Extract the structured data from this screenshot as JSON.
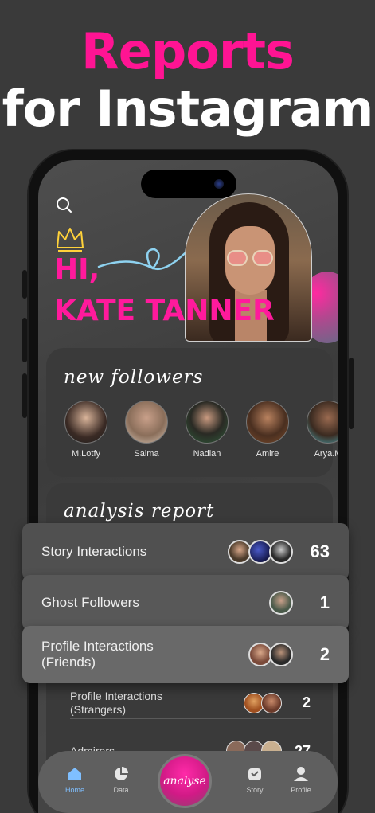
{
  "headline": {
    "line1": "Reports",
    "line2": "for Instagram"
  },
  "colors": {
    "accent": "#ff1493",
    "background": "#3a3a3a"
  },
  "greeting": {
    "line1": "HI,",
    "line2": "KATE TANNER"
  },
  "new_followers": {
    "title": "new followers",
    "items": [
      {
        "name": "M.Lotfy"
      },
      {
        "name": "Salma"
      },
      {
        "name": "Nadian"
      },
      {
        "name": "Amire"
      },
      {
        "name": "Arya.M"
      }
    ]
  },
  "analysis": {
    "title": "analysis report",
    "rows": [
      {
        "label": "Story Interactions",
        "count": "63"
      },
      {
        "label": "Ghost Followers",
        "count": "1"
      },
      {
        "label": "Profile Interactions (Friends)",
        "count": "2"
      },
      {
        "label": "Profile Interactions (Strangers)",
        "count": "2"
      },
      {
        "label": "Admirers",
        "count": "27"
      }
    ]
  },
  "nav": {
    "home": "Home",
    "data": "Data",
    "analyse": "analyse",
    "story": "Story",
    "profile": "Profile"
  }
}
